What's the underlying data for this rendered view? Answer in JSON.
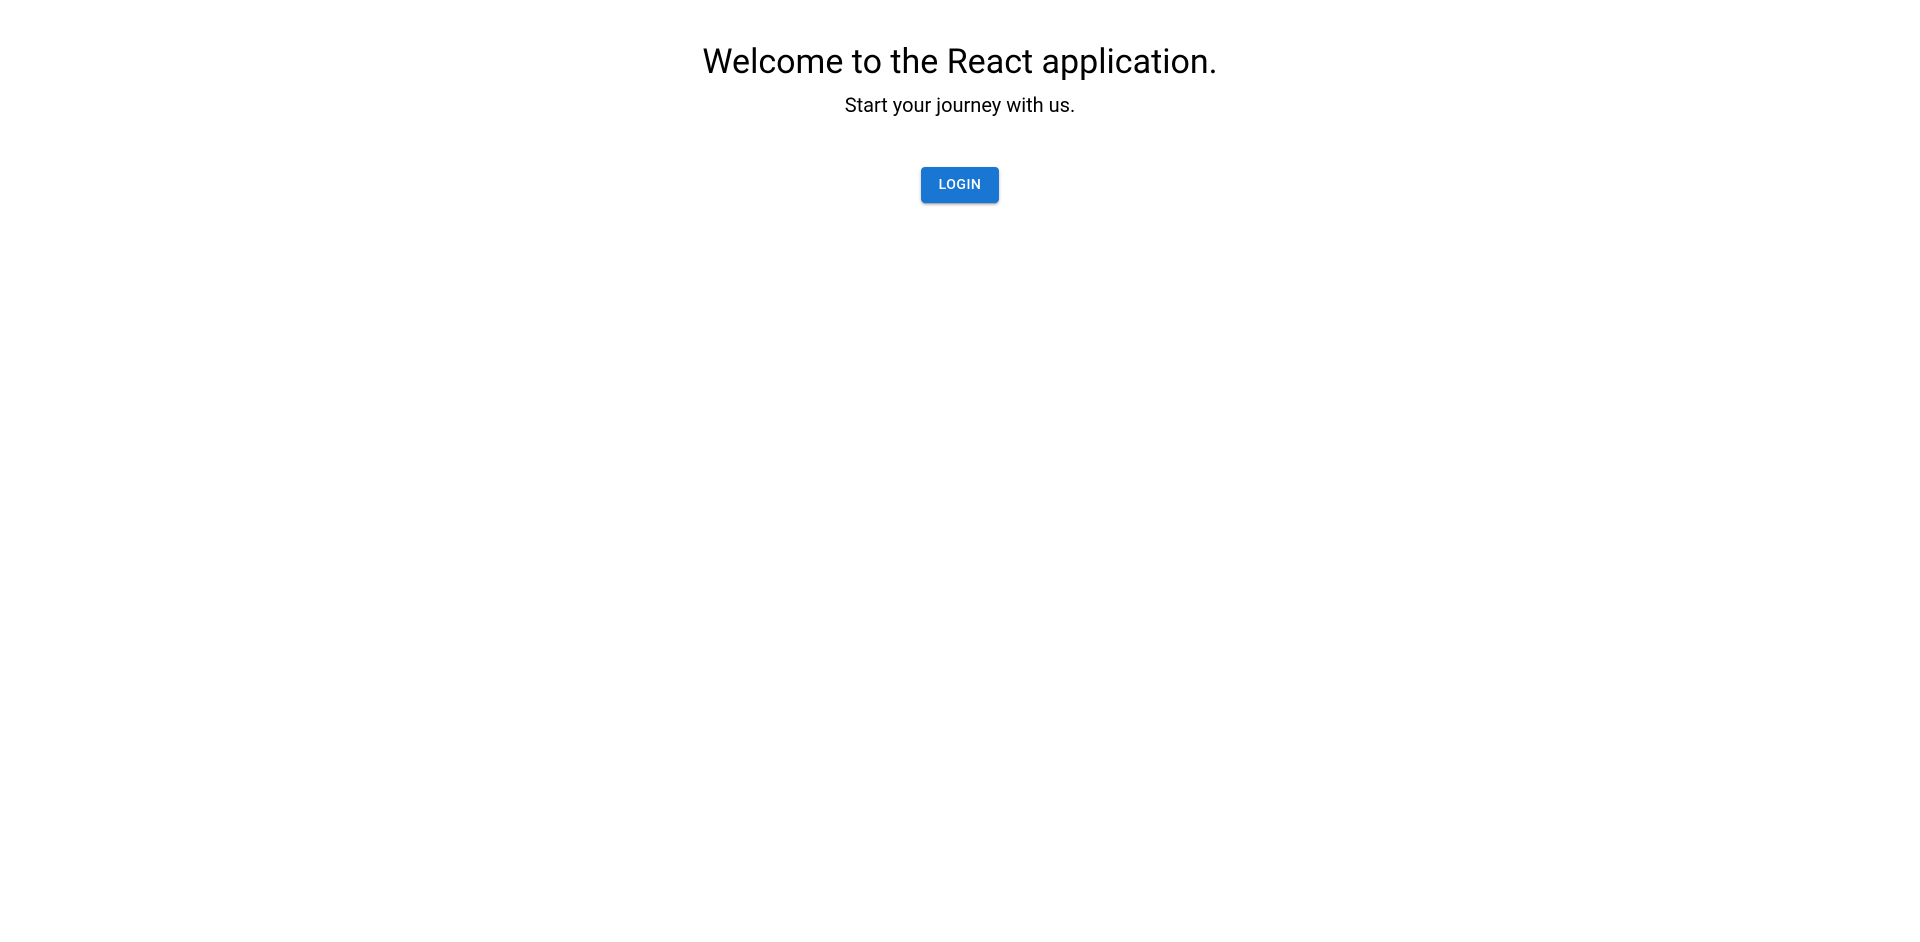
{
  "hero": {
    "title": "Welcome to the React application.",
    "subtitle": "Start your journey with us."
  },
  "actions": {
    "login_label": "LOGIN"
  }
}
